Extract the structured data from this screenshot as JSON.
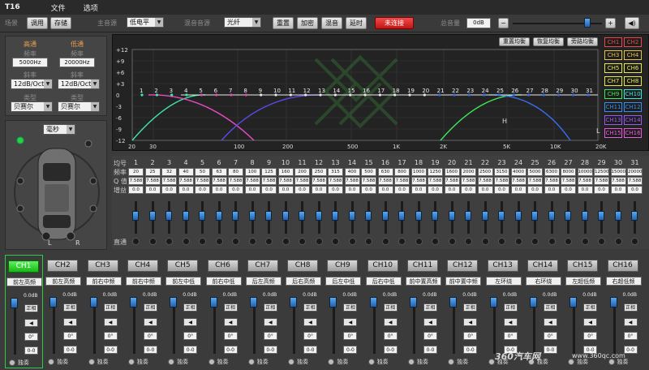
{
  "app": {
    "title": "T16",
    "menu": [
      "文件",
      "选项"
    ]
  },
  "toolbar": {
    "scene_label": "场景",
    "recall_label": "调用",
    "save_label": "存储",
    "main_source_label": "主音源",
    "main_source_value": "低电平",
    "mix_source_label": "混音音源",
    "mix_source_value": "光纤",
    "reset_label": "重置",
    "encrypt_label": "加密",
    "mixer_label": "混音",
    "delay_label": "延时",
    "connect_status": "未连接",
    "master_volume_label": "总音量",
    "master_volume_value": "0dB",
    "minus_label": "−",
    "plus_label": "+"
  },
  "crossover": {
    "hp_label": "高通",
    "lp_label": "低通",
    "freq_label": "频率",
    "hp_freq": "5000Hz",
    "lp_freq": "20000Hz",
    "slope_label": "斜率",
    "hp_slope": "12dB/Oct",
    "lp_slope": "12dB/Oct",
    "type_label": "类型",
    "hp_type": "贝赛尔",
    "lp_type": "贝赛尔"
  },
  "car": {
    "unit_value": "毫秒",
    "left_label": "L",
    "right_label": "R",
    "active_color": "#2ecc40"
  },
  "chart": {
    "reset_eq_label": "重置均衡",
    "restore_eq_label": "恢复均衡",
    "bypass_eq_label": "旁路均衡",
    "y_ticks": [
      "+12",
      "+9",
      "+6",
      "+3",
      "0",
      "-3",
      "-6",
      "-9",
      "-12"
    ],
    "x_ticks": [
      "20",
      "30",
      "100",
      "200",
      "500",
      "1K",
      "2K",
      "5K",
      "10K",
      "20K"
    ],
    "band_labels": [
      "1",
      "2",
      "3",
      "4",
      "5",
      "6",
      "7",
      "8",
      "9",
      "10",
      "11",
      "12",
      "13",
      "14",
      "15",
      "16",
      "17",
      "18",
      "19",
      "20",
      "21",
      "22",
      "23",
      "24",
      "25",
      "26",
      "27",
      "28",
      "29",
      "30",
      "31"
    ],
    "marker_h": "H",
    "marker_l": "L"
  },
  "channel_selector": [
    {
      "label": "CH1",
      "color": "#e84a4a"
    },
    {
      "label": "CH2",
      "color": "#e84a4a"
    },
    {
      "label": "CH3",
      "color": "#e8c04a"
    },
    {
      "label": "CH4",
      "color": "#e8c04a"
    },
    {
      "label": "CH5",
      "color": "#e8e84a"
    },
    {
      "label": "CH6",
      "color": "#e8e84a"
    },
    {
      "label": "CH7",
      "color": "#e8e84a"
    },
    {
      "label": "CH8",
      "color": "#e8e84a"
    },
    {
      "label": "CH9",
      "color": "#3ee85a"
    },
    {
      "label": "CH10",
      "color": "#3ee8d8"
    },
    {
      "label": "CH11",
      "color": "#3a8ef0"
    },
    {
      "label": "CH12",
      "color": "#3a8ef0"
    },
    {
      "label": "CH13",
      "color": "#9a5af0"
    },
    {
      "label": "CH14",
      "color": "#9a5af0"
    },
    {
      "label": "CH15",
      "color": "#e85ad8"
    },
    {
      "label": "CH16",
      "color": "#e85ad8"
    }
  ],
  "eq_table": {
    "row_labels": [
      "均号",
      "频率",
      "Q 值",
      "增益"
    ],
    "band_numbers": [
      "1",
      "2",
      "3",
      "4",
      "5",
      "6",
      "7",
      "8",
      "9",
      "10",
      "11",
      "12",
      "13",
      "14",
      "15",
      "16",
      "17",
      "18",
      "19",
      "20",
      "21",
      "22",
      "23",
      "24",
      "25",
      "26",
      "27",
      "28",
      "29",
      "30",
      "31"
    ],
    "freqs": [
      "20",
      "25",
      "32",
      "40",
      "50",
      "63",
      "80",
      "100",
      "125",
      "160",
      "200",
      "250",
      "315",
      "400",
      "500",
      "630",
      "800",
      "1000",
      "1250",
      "1600",
      "2000",
      "2500",
      "3150",
      "4000",
      "5000",
      "6300",
      "8000",
      "10000",
      "12500",
      "15000",
      "20000"
    ],
    "q": [
      "7.588",
      "7.588",
      "7.588",
      "7.588",
      "7.588",
      "7.588",
      "7.588",
      "7.588",
      "7.588",
      "7.588",
      "7.588",
      "7.588",
      "7.588",
      "7.588",
      "7.588",
      "7.588",
      "7.588",
      "7.588",
      "7.588",
      "7.588",
      "7.588",
      "7.588",
      "7.588",
      "7.588",
      "7.588",
      "7.588",
      "7.588",
      "7.588",
      "7.588",
      "7.588",
      "7.588"
    ],
    "gain": [
      "0.0",
      "0.0",
      "0.0",
      "0.0",
      "0.0",
      "0.0",
      "0.0",
      "0.0",
      "0.0",
      "0.0",
      "0.0",
      "0.0",
      "0.0",
      "0.0",
      "0.0",
      "0.0",
      "0.0",
      "0.0",
      "0.0",
      "0.0",
      "0.0",
      "0.0",
      "0.0",
      "0.0",
      "0.0",
      "0.0",
      "0.0",
      "0.0",
      "0.0",
      "0.0",
      "0.0"
    ],
    "bypass_label": "直通"
  },
  "channels": [
    {
      "label": "CH1",
      "name": "前左高频",
      "active": true
    },
    {
      "label": "CH2",
      "name": "前左高频",
      "active": false
    },
    {
      "label": "CH3",
      "name": "前右中频",
      "active": false
    },
    {
      "label": "CH4",
      "name": "前右中频",
      "active": false
    },
    {
      "label": "CH5",
      "name": "前左中低",
      "active": false
    },
    {
      "label": "CH6",
      "name": "前右中低",
      "active": false
    },
    {
      "label": "CH7",
      "name": "后左高频",
      "active": false
    },
    {
      "label": "CH8",
      "name": "后右高频",
      "active": false
    },
    {
      "label": "CH9",
      "name": "后左中低",
      "active": false
    },
    {
      "label": "CH10",
      "name": "后右中低",
      "active": false
    },
    {
      "label": "CH11",
      "name": "前中置高频",
      "active": false
    },
    {
      "label": "CH12",
      "name": "前中置中频",
      "active": false
    },
    {
      "label": "CH13",
      "name": "左环绕",
      "active": false
    },
    {
      "label": "CH14",
      "name": "右环绕",
      "active": false
    },
    {
      "label": "CH15",
      "name": "左超低频",
      "active": false
    },
    {
      "label": "CH16",
      "name": "右超低频",
      "active": false
    }
  ],
  "channel_controls": {
    "gain": "0.0dB",
    "phase": "正相",
    "delay": "0°",
    "link": "0-0",
    "solo": "独奏"
  },
  "watermark": {
    "brand": "360汽车网",
    "url": "www.360qc.com"
  }
}
